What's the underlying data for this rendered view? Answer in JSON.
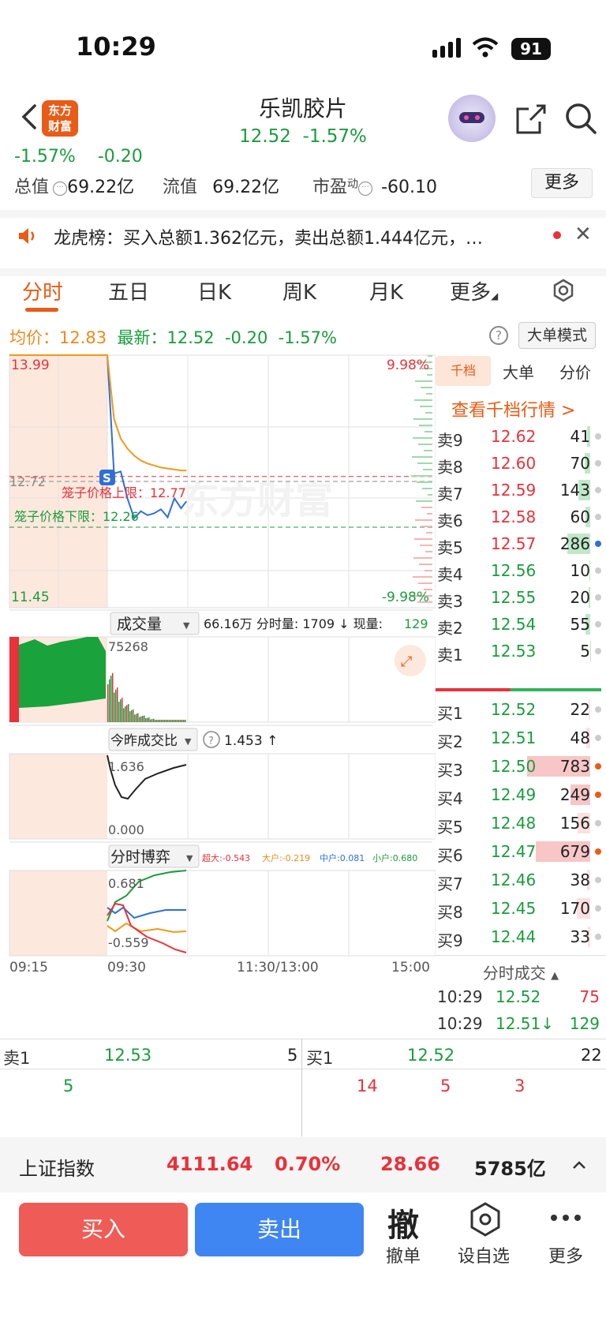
{
  "status_bar": {
    "time": "10:29",
    "battery": "91"
  },
  "header": {
    "logo_line1": "东方",
    "logo_line2": "财富",
    "stock_name": "乐凯胶片",
    "price": "12.52",
    "change_pct": "-1.57%"
  },
  "info": {
    "partial_values": [
      "-1.57%",
      "-0.20"
    ],
    "total_value_label": "总值",
    "total_value": "69.22亿",
    "float_value_label": "流值",
    "float_value": "69.22亿",
    "pe_label": "市盈",
    "pe_sup": "动",
    "pe_value": "-60.10",
    "more_label": "更多"
  },
  "dragon_tiger": {
    "text": "龙虎榜：买入总额1.362亿元，卖出总额1.444亿元，…"
  },
  "tabs": {
    "items": [
      "分时",
      "五日",
      "日K",
      "周K",
      "月K",
      "更多"
    ],
    "active": "分时"
  },
  "price_row": {
    "avg_label": "均价：",
    "avg_value": "12.83",
    "latest_label": "最新：",
    "latest_value": "12.52",
    "change": "-0.20",
    "change_pct": "-1.57%",
    "help": "?",
    "big_order_mode": "大单模式"
  },
  "chart": {
    "high_label": "13.99",
    "low_label": "11.45",
    "high_pct": "9.98%",
    "low_pct": "-9.98%",
    "ref_label": "12.72",
    "cage_upper": "笼子价格上限：12.77",
    "cage_lower": "笼子价格下限：12.26",
    "s_marker": "S",
    "watermark": "东方财富",
    "volume_dropdown": "成交量",
    "volume_info": "66.16万 分时量: 1709 ↓ 现量:",
    "volume_now": "129",
    "volume_max": "75268",
    "ratio_dropdown": "今昨成交比",
    "ratio_value": "1.453 ↑",
    "ratio_top": "1.636",
    "ratio_bottom": "0.000",
    "game_dropdown": "分时博弈",
    "game_super": "超大:-0.543",
    "game_large": "大户:-0.219",
    "game_mid": "中户:0.081",
    "game_small": "小户:0.680",
    "game_top": "0.681",
    "game_bottom": "-0.559",
    "time_labels": [
      "09:15",
      "09:30",
      "11:30/13:00",
      "15:00"
    ]
  },
  "chart_data": {
    "type": "line",
    "title": "",
    "xlabel": "",
    "ylabel": "",
    "ylim": [
      11.45,
      13.99
    ],
    "x": [
      "09:15",
      "09:30",
      "09:35",
      "09:40",
      "09:45",
      "09:50",
      "09:55",
      "10:00",
      "10:05",
      "10:10",
      "10:15",
      "10:20",
      "10:25",
      "10:29"
    ],
    "series": [
      {
        "values": [
          13.99,
          13.99,
          12.8,
          12.82,
          12.55,
          12.35,
          12.42,
          12.38,
          12.4,
          12.44,
          12.36,
          12.55,
          12.45,
          12.52
        ]
      },
      {
        "values": [
          13.99,
          13.99,
          13.35,
          13.15,
          13.05,
          12.98,
          12.93,
          12.9,
          12.88,
          12.86,
          12.85,
          12.84,
          12.83,
          12.83
        ]
      }
    ],
    "reference_lines": {
      "prev_close": 12.72,
      "cage_upper": 12.77,
      "cage_lower": 12.26
    }
  },
  "panel": {
    "tabs": [
      "千档",
      "大单",
      "分价"
    ],
    "view_thousand": "查看千档行情 >",
    "asks": [
      {
        "label": "卖9",
        "price": "12.62",
        "vol": "41",
        "color": "#e8313a"
      },
      {
        "label": "卖8",
        "price": "12.60",
        "vol": "70",
        "color": "#e8313a"
      },
      {
        "label": "卖7",
        "price": "12.59",
        "vol": "143",
        "color": "#e8313a"
      },
      {
        "label": "卖6",
        "price": "12.58",
        "vol": "60",
        "color": "#e8313a"
      },
      {
        "label": "卖5",
        "price": "12.57",
        "vol": "286",
        "color": "#e8313a"
      },
      {
        "label": "卖4",
        "price": "12.56",
        "vol": "10",
        "color": "#1a9c3c"
      },
      {
        "label": "卖3",
        "price": "12.55",
        "vol": "20",
        "color": "#1a9c3c"
      },
      {
        "label": "卖2",
        "price": "12.54",
        "vol": "55",
        "color": "#1a9c3c"
      },
      {
        "label": "卖1",
        "price": "12.53",
        "vol": "5",
        "color": "#1a9c3c"
      }
    ],
    "bids": [
      {
        "label": "买1",
        "price": "12.52",
        "vol": "22",
        "color": "#1a9c3c"
      },
      {
        "label": "买2",
        "price": "12.51",
        "vol": "48",
        "color": "#1a9c3c"
      },
      {
        "label": "买3",
        "price": "12.50",
        "vol": "783",
        "color": "#1a9c3c"
      },
      {
        "label": "买4",
        "price": "12.49",
        "vol": "249",
        "color": "#1a9c3c"
      },
      {
        "label": "买5",
        "price": "12.48",
        "vol": "156",
        "color": "#1a9c3c"
      },
      {
        "label": "买6",
        "price": "12.47",
        "vol": "679",
        "color": "#1a9c3c"
      },
      {
        "label": "买7",
        "price": "12.46",
        "vol": "38",
        "color": "#1a9c3c"
      },
      {
        "label": "买8",
        "price": "12.45",
        "vol": "170",
        "color": "#1a9c3c"
      },
      {
        "label": "买9",
        "price": "12.44",
        "vol": "33",
        "color": "#1a9c3c"
      }
    ],
    "tick_header": "分时成交",
    "ticks": [
      {
        "time": "10:29",
        "price": "12.52",
        "vol": "75",
        "vol_color": "#e8313a"
      },
      {
        "time": "10:29",
        "price": "12.51↓",
        "vol": "129",
        "vol_color": "#1a9c3c"
      }
    ]
  },
  "quick": {
    "sell_label": "卖1",
    "sell_price": "12.53",
    "sell_vol": "5",
    "sell_sub": "5",
    "buy_label": "买1",
    "buy_price": "12.52",
    "buy_vol": "22",
    "buy_subs": [
      "14",
      "5",
      "3"
    ]
  },
  "index": {
    "name": "上证指数",
    "value": "4111.64",
    "pct": "0.70%",
    "change": "28.66",
    "turnover": "5785亿"
  },
  "bottom": {
    "buy": "买入",
    "sell": "卖出",
    "cancel_glyph": "撤",
    "cancel": "撤单",
    "watch": "设自选",
    "more": "更多"
  }
}
